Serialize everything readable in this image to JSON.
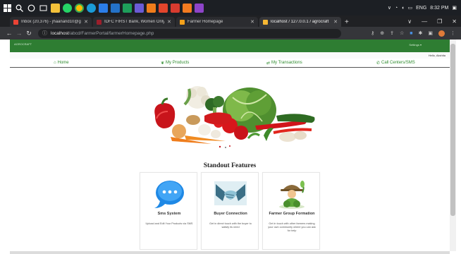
{
  "taskbar": {
    "tray_lang": "ENG",
    "tray_time": "8:32 PM"
  },
  "tabs": [
    {
      "label": "Inbox (20,376) - jhaanand10@g",
      "favicon_color": "#ea4335",
      "active": false
    },
    {
      "label": "IDFC FIRST Bank, Women Only C",
      "favicon_color": "#9c1f2b",
      "active": false
    },
    {
      "label": "Farmer Homepage",
      "favicon_color": "#f2a01b",
      "active": false
    },
    {
      "label": "localhost / 127.0.0.1 / agrocraft",
      "favicon_color": "#f7b733",
      "active": true
    }
  ],
  "address_bar": {
    "host": "localhost",
    "path": "/abcd/FarmerPortal/farmerHomepage.php"
  },
  "site": {
    "brand": "AGROCRAFT",
    "settings_label": "Settings ▾",
    "user_label": "Hello, Akshita"
  },
  "nav": {
    "home": "Home",
    "products": "My Products",
    "transactions": "My Transactions",
    "call_centers": "Call Centers/SMS"
  },
  "features": {
    "title": "Standout Features",
    "cards": [
      {
        "title": "Sms System",
        "desc": "Upload and Edit Your Products via SMS"
      },
      {
        "title": "Buyer Connection",
        "desc": "Get in direct touch with the buyer to satisfy its need"
      },
      {
        "title": "Farmer Group Formation",
        "desc": "Get in touch with other farmers making your own community where you can ask for help"
      }
    ]
  },
  "colors": {
    "accent_green": "#2e8b2e",
    "header_green": "#2e7d32"
  }
}
